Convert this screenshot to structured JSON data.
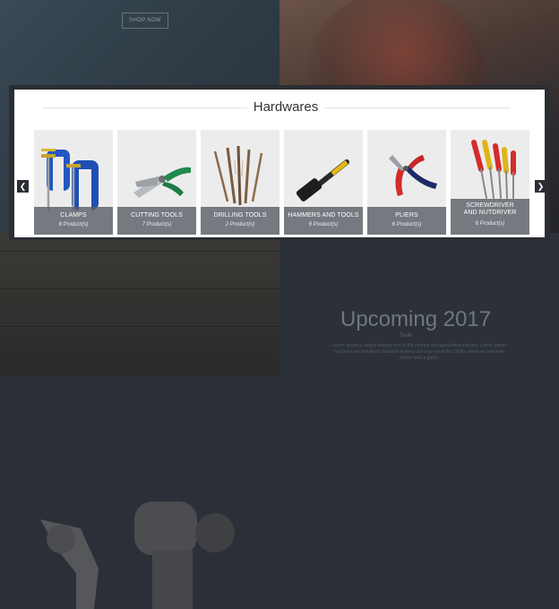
{
  "background": {
    "shop_now_label": "SHOP NOW",
    "upcoming_title": "Upcoming 2017",
    "upcoming_subtitle": "Tools",
    "upcoming_body": "Lorem ipsum is simply dummy text of the printing and typesetting industry. Lorem Ipsum has been the industry's standard dummy text ever since the 1500s, when an unknown printer took a galley"
  },
  "modal": {
    "title": "Hardwares",
    "prev_icon": "chevron-left-icon",
    "next_icon": "chevron-right-icon",
    "categories": [
      {
        "name": "CLAMPS",
        "count": "8 Product(s)",
        "icon": "clamp-icon"
      },
      {
        "name": "CUTTING TOOLS",
        "count": "7 Product(s)",
        "icon": "pruning-shears-icon"
      },
      {
        "name": "DRILLING TOOLS",
        "count": "2 Product(s)",
        "icon": "drill-bits-icon"
      },
      {
        "name": "HAMMERS AND TOOLS",
        "count": "6 Product(s)",
        "icon": "hammer-icon"
      },
      {
        "name": "PLIERS",
        "count": "6 Product(s)",
        "icon": "pliers-icon"
      },
      {
        "name": "SCREWDRIVER AND NUTDRIVER",
        "count": "6 Product(s)",
        "icon": "screwdriver-set-icon"
      }
    ]
  }
}
